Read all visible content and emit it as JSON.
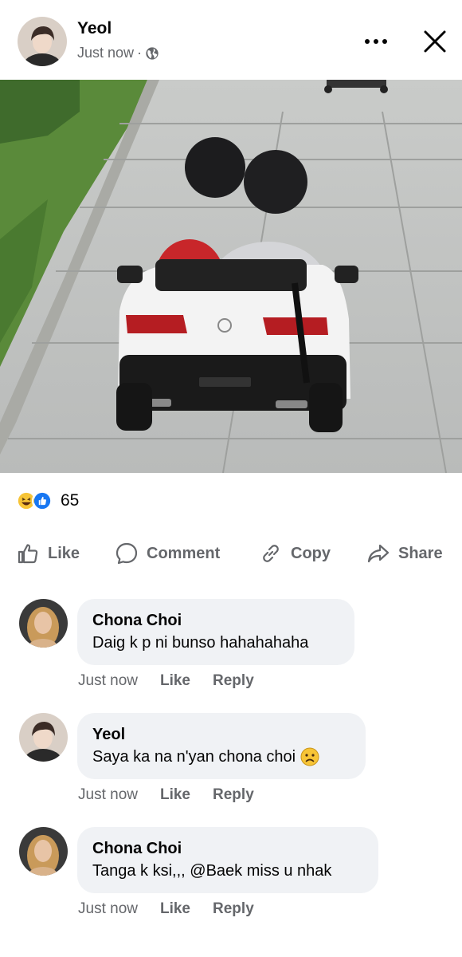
{
  "post": {
    "author": "Yeol",
    "timestamp": "Just now",
    "separator": "·",
    "privacy_icon": "globe-icon",
    "more_icon": "more-icon",
    "close_icon": "close-icon"
  },
  "reactions": {
    "icons": [
      "haha-icon",
      "like-icon"
    ],
    "count": "65"
  },
  "actions": {
    "like": "Like",
    "comment": "Comment",
    "copy": "Copy",
    "share": "Share"
  },
  "comments": [
    {
      "author": "Chona Choi",
      "text": "Daig k p ni bunso hahahahaha",
      "time": "Just now",
      "like": "Like",
      "reply": "Reply"
    },
    {
      "author": "Yeol",
      "text": "Saya ka na n'yan chona choi",
      "emoji": "sad-face-icon",
      "time": "Just now",
      "like": "Like",
      "reply": "Reply"
    },
    {
      "author": "Chona Choi",
      "text": "Tanga k ksi,,, @Baek miss u nhak",
      "time": "Just now",
      "like": "Like",
      "reply": "Reply"
    }
  ],
  "colors": {
    "secondary_text": "#65676b",
    "bubble_bg": "#f0f2f5",
    "like_blue": "#1877f2",
    "haha_yellow": "#f7c436"
  }
}
